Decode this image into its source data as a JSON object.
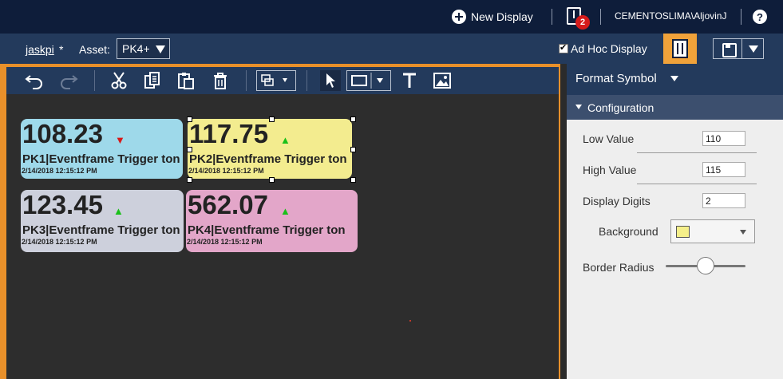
{
  "topbar": {
    "new_display_label": "New Display",
    "notification_count": "2",
    "username": "CEMENTOSLIMA\\AljovinJ",
    "help_label": "?"
  },
  "subbar": {
    "display_name": "jaskpi",
    "modified_marker": "*",
    "asset_label": "Asset:",
    "asset_value": "PK4+",
    "adhoc_label": "Ad Hoc Display",
    "adhoc_checked": true
  },
  "tiles": [
    {
      "value": "108.23",
      "label": "PK1|Eventframe Trigger ton",
      "timestamp": "2/14/2018 12:15:12 PM",
      "trend": "down",
      "arrow": "▼",
      "color": "#9ed9ea"
    },
    {
      "value": "117.75",
      "label": "PK2|Eventframe Trigger ton",
      "timestamp": "2/14/2018 12:15:12 PM",
      "trend": "up",
      "arrow": "▲",
      "color": "#f3ec8f"
    },
    {
      "value": "123.45",
      "label": "PK3|Eventframe Trigger ton",
      "timestamp": "2/14/2018 12:15:12 PM",
      "trend": "up",
      "arrow": "▲",
      "color": "#cdd0dc"
    },
    {
      "value": "562.07",
      "label": "PK4|Eventframe Trigger ton",
      "timestamp": "2/14/2018 12:15:12 PM",
      "trend": "up",
      "arrow": "▲",
      "color": "#e3a6c9"
    }
  ],
  "toolbar": {
    "icons": [
      "undo-icon",
      "redo-icon",
      "cut-icon",
      "copy-icon",
      "paste-icon",
      "delete-icon",
      "arrange-icon",
      "select-icon",
      "rectangle-icon",
      "text-icon",
      "image-icon"
    ]
  },
  "panel": {
    "title": "Format Symbol",
    "section_title": "Configuration",
    "low_value_label": "Low Value",
    "low_value": "110",
    "high_value_label": "High Value",
    "high_value": "115",
    "display_digits_label": "Display Digits",
    "display_digits": "2",
    "background_label": "Background",
    "background_color": "#f5ef8a",
    "border_radius_label": "Border Radius",
    "border_radius_level": 0.5
  },
  "colors": {
    "header": "#0e1d3a",
    "subbar": "#233a5c",
    "accent_orange": "#e8902a",
    "canvas": "#2d2d2d"
  }
}
